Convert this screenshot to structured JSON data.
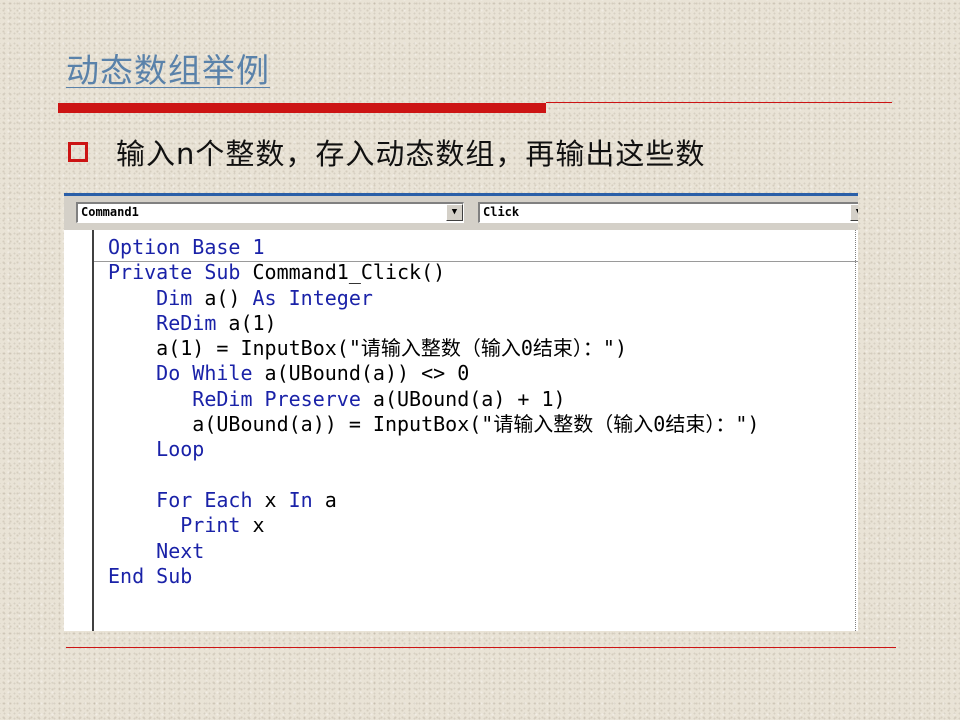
{
  "slide": {
    "title": "动态数组举例",
    "bullet": "输入n个整数，存入动态数组，再输出这些数"
  },
  "editor": {
    "object_combo": "Command1",
    "procedure_combo": "Click",
    "dropdown_glyph": "▼",
    "code": [
      [
        {
          "t": "Option Base 1",
          "k": true
        }
      ],
      [
        {
          "t": "Private Sub ",
          "k": true
        },
        {
          "t": "Command1_Click()",
          "k": false
        }
      ],
      [
        {
          "t": "    ",
          "k": false
        },
        {
          "t": "Dim ",
          "k": true
        },
        {
          "t": "a() ",
          "k": false
        },
        {
          "t": "As Integer",
          "k": true
        }
      ],
      [
        {
          "t": "    ",
          "k": false
        },
        {
          "t": "ReDim ",
          "k": true
        },
        {
          "t": "a(1)",
          "k": false
        }
      ],
      [
        {
          "t": "    a(1) = InputBox(\"请输入整数（输入0结束）：\")",
          "k": false
        }
      ],
      [
        {
          "t": "    ",
          "k": false
        },
        {
          "t": "Do While ",
          "k": true
        },
        {
          "t": "a(UBound(a)) <> 0",
          "k": false
        }
      ],
      [
        {
          "t": "       ",
          "k": false
        },
        {
          "t": "ReDim Preserve ",
          "k": true
        },
        {
          "t": "a(UBound(a) + 1)",
          "k": false
        }
      ],
      [
        {
          "t": "       a(UBound(a)) = InputBox(\"请输入整数（输入0结束）：\")",
          "k": false
        }
      ],
      [
        {
          "t": "    ",
          "k": false
        },
        {
          "t": "Loop",
          "k": true
        }
      ],
      [
        {
          "t": "",
          "k": false
        }
      ],
      [
        {
          "t": "    ",
          "k": false
        },
        {
          "t": "For Each ",
          "k": true
        },
        {
          "t": "x ",
          "k": false
        },
        {
          "t": "In ",
          "k": true
        },
        {
          "t": "a",
          "k": false
        }
      ],
      [
        {
          "t": "      ",
          "k": false
        },
        {
          "t": "Print ",
          "k": true
        },
        {
          "t": "x",
          "k": false
        }
      ],
      [
        {
          "t": "    ",
          "k": false
        },
        {
          "t": "Next",
          "k": true
        }
      ],
      [
        {
          "t": "End Sub",
          "k": true
        }
      ]
    ]
  }
}
